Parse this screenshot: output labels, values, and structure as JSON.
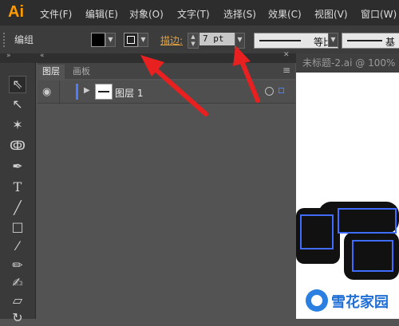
{
  "app": {
    "logo": "Ai"
  },
  "menu": [
    "文件(F)",
    "编辑(E)",
    "对象(O)",
    "文字(T)",
    "选择(S)",
    "效果(C)",
    "视图(V)",
    "窗口(W)"
  ],
  "control_bar": {
    "selection_label": "编组",
    "fill_color": "#000000",
    "stroke_label": "描边:",
    "stroke_weight": "7 pt",
    "profile_label": "等比",
    "brush_label": "基"
  },
  "layers_panel": {
    "tabs": [
      "图层",
      "画板"
    ],
    "menu_icon": "≡",
    "layer": {
      "name": "图层 1",
      "color": "#4d7cff"
    }
  },
  "document": {
    "tab_title": "未标题-2.ai @ 100%"
  },
  "watermark": {
    "text": "雪花家园"
  },
  "colors": {
    "menubar": "#2d2d2d",
    "panel": "#535353",
    "accent": "#ff9a00",
    "annotation": "#e82020"
  }
}
